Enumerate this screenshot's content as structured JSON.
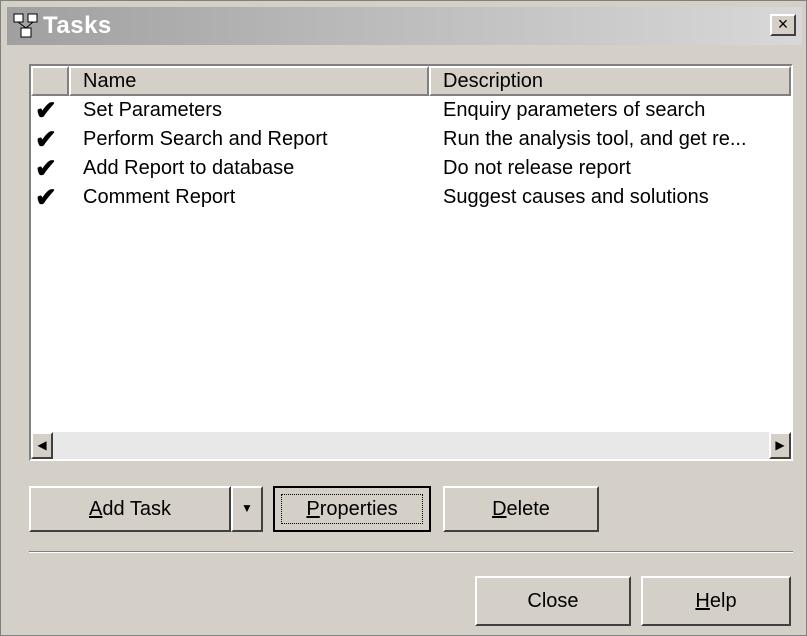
{
  "window": {
    "title": "Tasks",
    "close_glyph": "×"
  },
  "list": {
    "columns": [
      "Name",
      "Description"
    ],
    "rows": [
      {
        "done": true,
        "name": "Set Parameters",
        "description": "Enquiry parameters of search"
      },
      {
        "done": true,
        "name": "Perform Search and Report",
        "description": "Run the analysis tool, and get re..."
      },
      {
        "done": true,
        "name": "Add Report to database",
        "description": "Do not release report"
      },
      {
        "done": true,
        "name": "Comment Report",
        "description": "Suggest causes and solutions"
      }
    ],
    "check_glyph": "✔"
  },
  "buttons": {
    "add_task": {
      "mnemonic": "A",
      "rest": "dd Task"
    },
    "properties": {
      "mnemonic": "P",
      "rest": "roperties"
    },
    "delete": {
      "mnemonic": "D",
      "rest": "elete"
    },
    "close": "Close",
    "help": {
      "mnemonic": "H",
      "rest": "elp"
    }
  },
  "icons": {
    "title": "tasks-network-icon",
    "dropdown": "chevron-down-icon",
    "scroll_left": "arrow-left-icon",
    "scroll_right": "arrow-right-icon"
  }
}
